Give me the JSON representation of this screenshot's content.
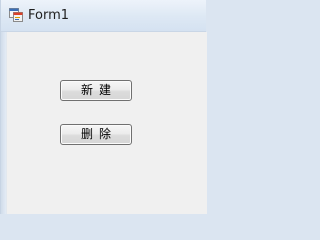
{
  "window": {
    "title": "Form1",
    "icon": "winforms-app-icon"
  },
  "buttons": {
    "new_label": "新建",
    "delete_label": "删除"
  },
  "colors": {
    "titlebar": "#dde8f4",
    "client_background": "#f0f0f0",
    "button_border": "#707070"
  }
}
